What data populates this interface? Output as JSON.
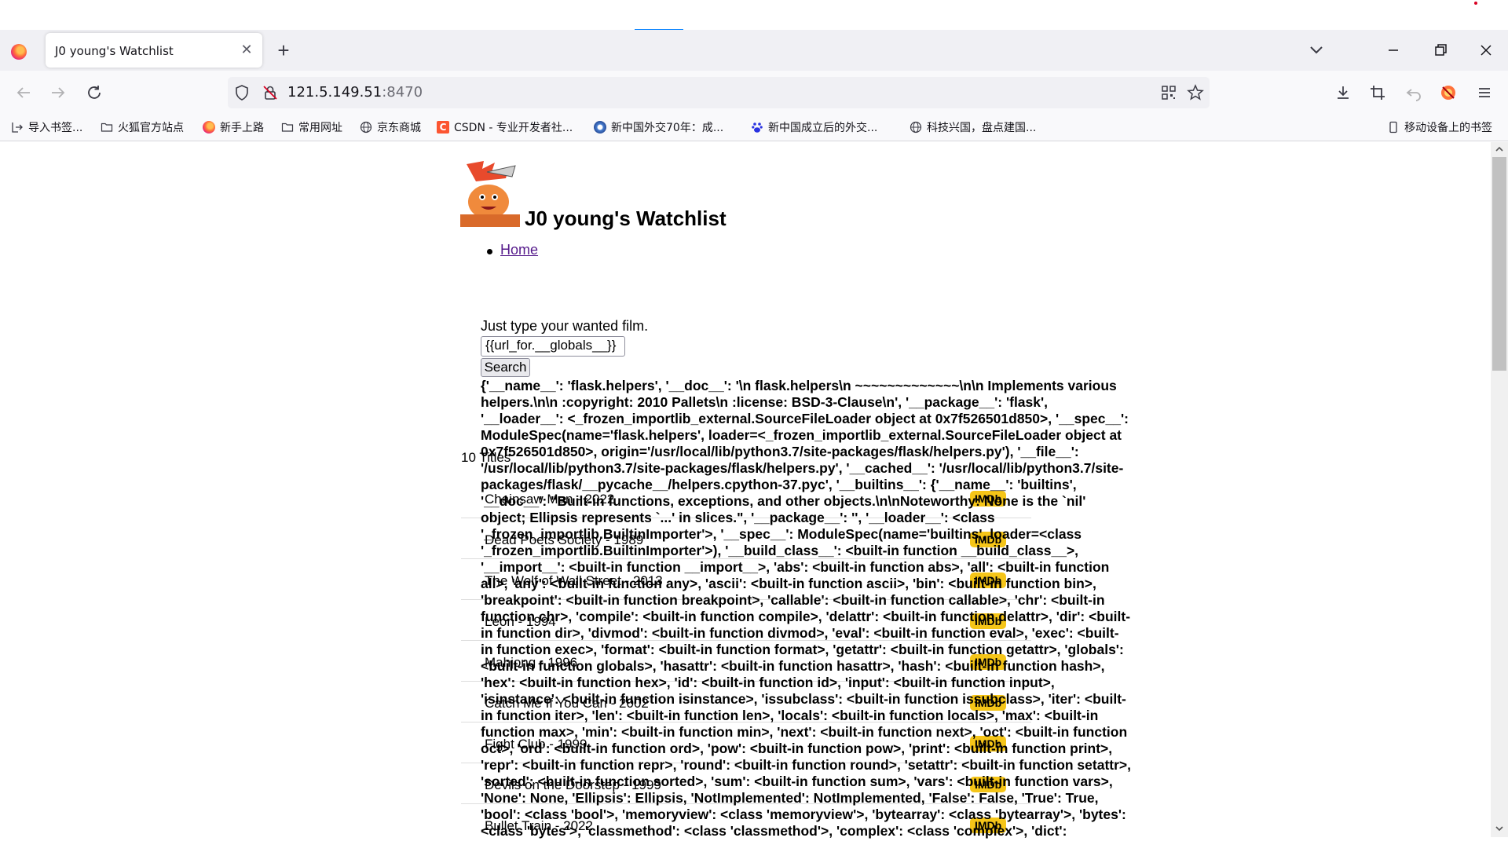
{
  "browser": {
    "tab_title": "J0 young's Watchlist",
    "url_host": "121.5.149.51",
    "url_port": ":8470",
    "bookmarks": [
      {
        "label": "导入书签...",
        "icon": "import-icon"
      },
      {
        "label": "火狐官方站点",
        "icon": "folder-icon"
      },
      {
        "label": "新手上路",
        "icon": "firefox-icon"
      },
      {
        "label": "常用网址",
        "icon": "folder-icon"
      },
      {
        "label": "京东商城",
        "icon": "globe-icon"
      },
      {
        "label": "CSDN - 专业开发者社...",
        "icon": "csdn-icon"
      },
      {
        "label": "新中国外交70年：成...",
        "icon": "site-icon"
      },
      {
        "label": "新中国成立后的外交...",
        "icon": "baidu-icon"
      },
      {
        "label": "科技兴国，盘点建国...",
        "icon": "globe-icon"
      }
    ],
    "mobile_bookmarks": "移动设备上的书签"
  },
  "page": {
    "title": "J0 young's Watchlist",
    "nav_home": "Home",
    "prompt": "Just type your wanted film.",
    "search_value": "{{url_for.__globals__}}",
    "search_button": "Search",
    "count_label": "10 Titles",
    "imdb_label": "IMDb",
    "movies": [
      "Chainsaw Man - 2022",
      "Dead Poets Society - 1989",
      "The Wolf of Wall Street - 2013",
      "Leon - 1994",
      "Mahjong - 1996",
      "Catch Me If You Can - 2002",
      "Fight Club - 1999",
      "Devils on the Doorstep - 1999",
      "Bullet Train - 2022"
    ],
    "dump": "{'__name__': 'flask.helpers', '__doc__': '\\n flask.helpers\\n ~~~~~~~~~~~~~\\n\\n Implements various helpers.\\n\\n :copyright: 2010 Pallets\\n :license: BSD-3-Clause\\n', '__package__': 'flask', '__loader__': <_frozen_importlib_external.SourceFileLoader object at 0x7f526501d850>, '__spec__': ModuleSpec(name='flask.helpers', loader=<_frozen_importlib_external.SourceFileLoader object at 0x7f526501d850>, origin='/usr/local/lib/python3.7/site-packages/flask/helpers.py'), '__file__': '/usr/local/lib/python3.7/site-packages/flask/helpers.py', '__cached__': '/usr/local/lib/python3.7/site-packages/flask/__pycache__/helpers.cpython-37.pyc', '__builtins__': {'__name__': 'builtins', '__doc__': \"Built-in functions, exceptions, and other objects.\\n\\nNoteworthy: None is the `nil' object; Ellipsis represents `...' in slices.\", '__package__': '', '__loader__': <class '_frozen_importlib.BuiltinImporter'>, '__spec__': ModuleSpec(name='builtins', loader=<class '_frozen_importlib.BuiltinImporter'>), '__build_class__': <built-in function __build_class__>, '__import__': <built-in function __import__>, 'abs': <built-in function abs>, 'all': <built-in function all>, 'any': <built-in function any>, 'ascii': <built-in function ascii>, 'bin': <built-in function bin>, 'breakpoint': <built-in function breakpoint>, 'callable': <built-in function callable>, 'chr': <built-in function chr>, 'compile': <built-in function compile>, 'delattr': <built-in function delattr>, 'dir': <built-in function dir>, 'divmod': <built-in function divmod>, 'eval': <built-in function eval>, 'exec': <built-in function exec>, 'format': <built-in function format>, 'getattr': <built-in function getattr>, 'globals': <built-in function globals>, 'hasattr': <built-in function hasattr>, 'hash': <built-in function hash>, 'hex': <built-in function hex>, 'id': <built-in function id>, 'input': <built-in function input>, 'isinstance': <built-in function isinstance>, 'issubclass': <built-in function issubclass>, 'iter': <built-in function iter>, 'len': <built-in function len>, 'locals': <built-in function locals>, 'max': <built-in function max>, 'min': <built-in function min>, 'next': <built-in function next>, 'oct': <built-in function oct>, 'ord': <built-in function ord>, 'pow': <built-in function pow>, 'print': <built-in function print>, 'repr': <built-in function repr>, 'round': <built-in function round>, 'setattr': <built-in function setattr>, 'sorted': <built-in function sorted>, 'sum': <built-in function sum>, 'vars': <built-in function vars>, 'None': None, 'Ellipsis': Ellipsis, 'NotImplemented': NotImplemented, 'False': False, 'True': True, 'bool': <class 'bool'>, 'memoryview': <class 'memoryview'>, 'bytearray': <class 'bytearray'>, 'bytes': <class 'bytes'>, 'classmethod': <class 'classmethod'>, 'complex': <class 'complex'>, 'dict':"
  },
  "colors": {
    "accent": "#0a84ff",
    "imdb": "#f5c518",
    "link_visited": "#551a8b"
  }
}
